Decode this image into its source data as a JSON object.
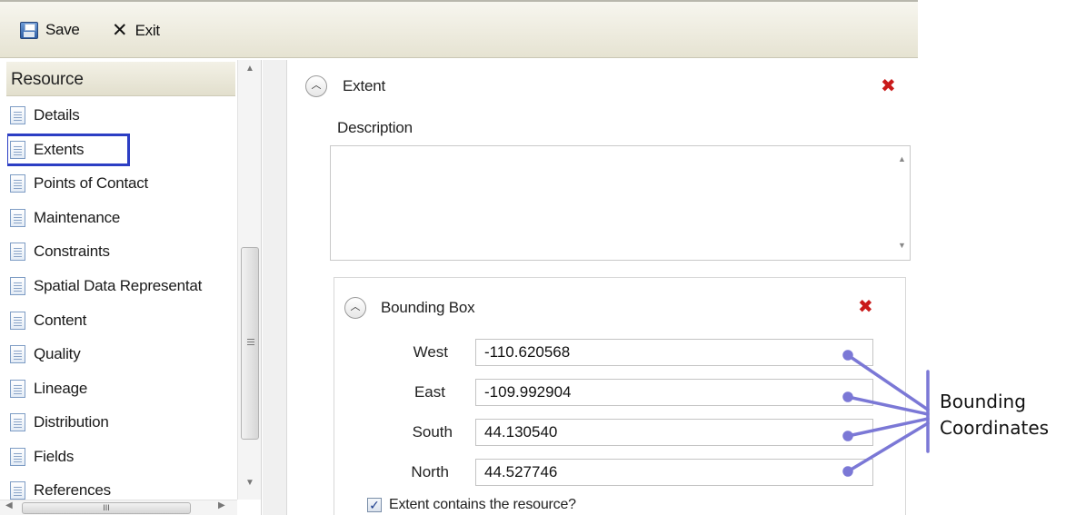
{
  "toolbar": {
    "save_label": "Save",
    "exit_label": "Exit"
  },
  "sidebar": {
    "header": "Resource",
    "items": [
      {
        "label": "Details"
      },
      {
        "label": "Extents",
        "selected": true
      },
      {
        "label": "Points of Contact"
      },
      {
        "label": "Maintenance"
      },
      {
        "label": "Constraints"
      },
      {
        "label": "Spatial Data Representat"
      },
      {
        "label": "Content"
      },
      {
        "label": "Quality"
      },
      {
        "label": "Lineage"
      },
      {
        "label": "Distribution"
      },
      {
        "label": "Fields"
      },
      {
        "label": "References"
      }
    ],
    "hscroll_grip": "III"
  },
  "extent": {
    "title": "Extent",
    "description_label": "Description",
    "description_value": ""
  },
  "bounding_box": {
    "title": "Bounding Box",
    "west_label": "West",
    "west_value": "-110.620568",
    "east_label": "East",
    "east_value": "-109.992904",
    "south_label": "South",
    "south_value": "44.130540",
    "north_label": "North",
    "north_value": "44.527746",
    "contains_label": "Extent contains the resource?",
    "contains_checked": true
  },
  "annotation": {
    "line1": "Bounding",
    "line2": "Coordinates"
  },
  "colors": {
    "selection_outline": "#2c3ec4",
    "annotation_line": "#7b78d6",
    "close_x": "#c91a1a"
  },
  "icons": {
    "save": "save-icon",
    "exit": "exit-icon",
    "nav": "document-icon",
    "collapse": "chevron-up-icon",
    "remove": "close-icon",
    "check": "checkmark-icon"
  }
}
